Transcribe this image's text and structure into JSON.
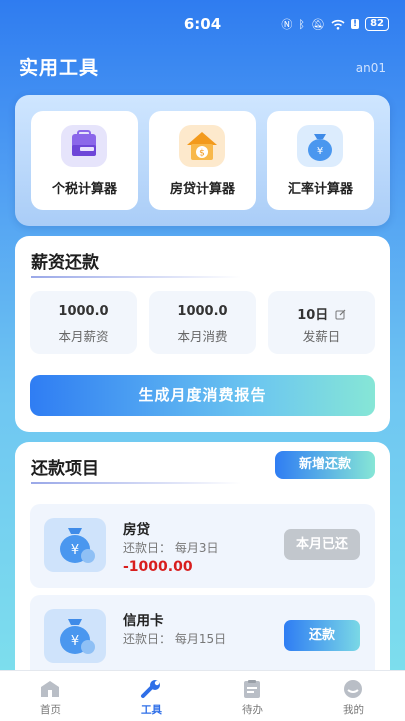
{
  "status": {
    "time": "6:04",
    "battery": "82"
  },
  "header": {
    "title": "实用工具",
    "user": "an01"
  },
  "tools": [
    {
      "label": "个税计算器",
      "icon": "tax-calculator-icon"
    },
    {
      "label": "房贷计算器",
      "icon": "house-loan-icon"
    },
    {
      "label": "汇率计算器",
      "icon": "money-bag-icon"
    }
  ],
  "salary": {
    "title": "薪资还款",
    "stats": [
      {
        "value": "1000.0",
        "label": "本月薪资"
      },
      {
        "value": "1000.0",
        "label": "本月消费"
      },
      {
        "value": "10日",
        "label": "发薪日"
      }
    ],
    "report_button": "生成月度消费报告"
  },
  "repay": {
    "title": "还款项目",
    "add_button": "新增还款",
    "items": [
      {
        "name": "房贷",
        "date": "还款日： 每月3日",
        "amount": "-1000.00",
        "button": "本月已还"
      },
      {
        "name": "信用卡",
        "date": "还款日： 每月15日",
        "amount": "",
        "button": "还款"
      }
    ]
  },
  "tabbar": [
    {
      "label": "首页",
      "icon": "home-icon"
    },
    {
      "label": "工具",
      "icon": "wrench-icon"
    },
    {
      "label": "待办",
      "icon": "clipboard-icon"
    },
    {
      "label": "我的",
      "icon": "profile-icon"
    }
  ],
  "colors": {
    "primary": "#2f7df3",
    "accent": "#86e6d6",
    "danger": "#d81e1e",
    "disabled": "#c2c7cd"
  }
}
